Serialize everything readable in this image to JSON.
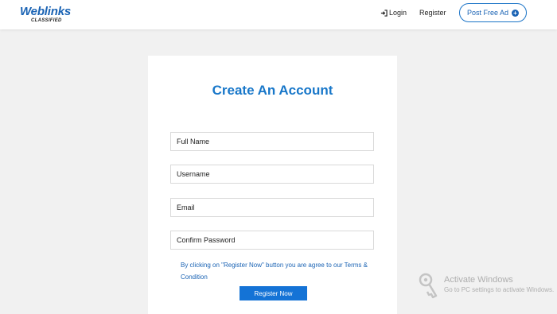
{
  "header": {
    "logo_main": "Weblinks",
    "logo_sub": "CLASSIFIED",
    "login_label": "Login",
    "register_label": "Register",
    "post_ad_label": "Post Free Ad"
  },
  "form": {
    "title": "Create An Account",
    "fields": [
      {
        "placeholder": "Full Name",
        "value": ""
      },
      {
        "placeholder": "Username",
        "value": ""
      },
      {
        "placeholder": "Email",
        "value": ""
      },
      {
        "placeholder": "Confirm Password",
        "value": ""
      }
    ],
    "terms_prefix": "By clicking on \"Register Now\" button you are agree to our ",
    "terms_link": "Terms & Condition",
    "submit_label": "Register Now"
  },
  "watermark": {
    "title": "Activate Windows",
    "subtitle": "Go to PC settings to activate Windows."
  },
  "colors": {
    "brand": "#1a63b4",
    "title": "#1877c9",
    "button": "#1473d6",
    "background": "#f1f1f1"
  },
  "icons": [
    "sign-in-icon",
    "plus-circle-icon",
    "key-icon"
  ]
}
